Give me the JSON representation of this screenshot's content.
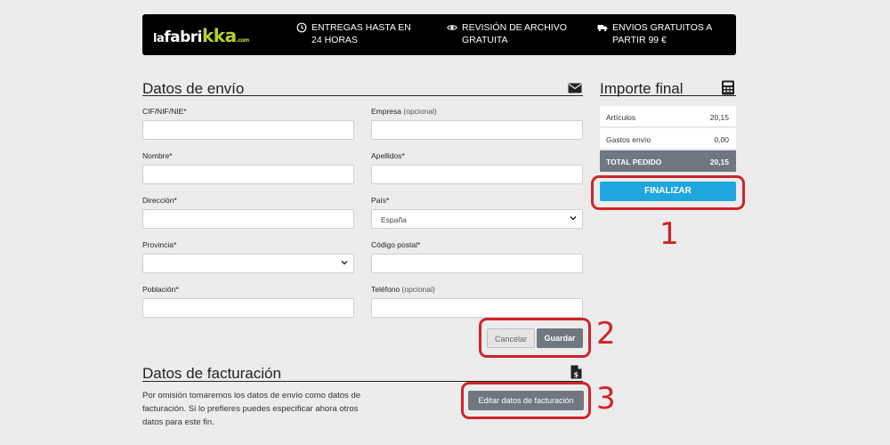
{
  "brand": {
    "logo_la": "la",
    "logo_fabri": "fabri",
    "logo_kka": "kka",
    "logo_com": ".com"
  },
  "perks": [
    {
      "icon": "clock-icon",
      "text": "ENTREGAS HASTA EN 24 HORAS"
    },
    {
      "icon": "eye-icon",
      "text": "REVISIÓN DE ARCHIVO GRATUITA"
    },
    {
      "icon": "truck-icon",
      "text": "ENVIOS GRATUITOS A PARTIR 99 €"
    }
  ],
  "shipping": {
    "title": "Datos de envío",
    "icon": "envelope-icon",
    "fields": {
      "cif": {
        "label": "CIF/NIF/NIE*",
        "value": ""
      },
      "empresa": {
        "label": "Empresa",
        "optional": "(opcional)",
        "value": ""
      },
      "nombre": {
        "label": "Nombre*",
        "value": ""
      },
      "apellidos": {
        "label": "Apellidos*",
        "value": ""
      },
      "direccion": {
        "label": "Dirección*",
        "value": ""
      },
      "pais": {
        "label": "País*",
        "value": "España"
      },
      "provincia": {
        "label": "Provincia*",
        "value": ""
      },
      "codigo_postal": {
        "label": "Código postal*",
        "value": ""
      },
      "poblacion": {
        "label": "Población*",
        "value": ""
      },
      "telefono": {
        "label": "Teléfono",
        "optional": "(opcional)",
        "value": ""
      }
    },
    "cancel_label": "Cancelar",
    "save_label": "Guardar"
  },
  "summary": {
    "title": "Importe final",
    "icon": "calculator-icon",
    "rows": [
      {
        "label": "Artículos",
        "value": "20,15"
      },
      {
        "label": "Gastos envío",
        "value": "0,00"
      }
    ],
    "total_label": "TOTAL PEDIDO",
    "total_value": "20,15",
    "finalize_label": "FINALIZAR"
  },
  "billing": {
    "title": "Datos de facturación",
    "icon": "invoice-icon",
    "text": "Por omisión tomaremos los datos de envío como datos de facturación. Si lo prefieres puedes especificar ahora otros datos para este fin.",
    "edit_label": "Editar datos de facturación"
  },
  "callouts": {
    "one": "1",
    "two": "2",
    "three": "3"
  },
  "colors": {
    "accent": "#1ea7dd",
    "highlight": "#d0242a",
    "logo_green": "#b6d12a",
    "button_gray": "#6f7780"
  }
}
